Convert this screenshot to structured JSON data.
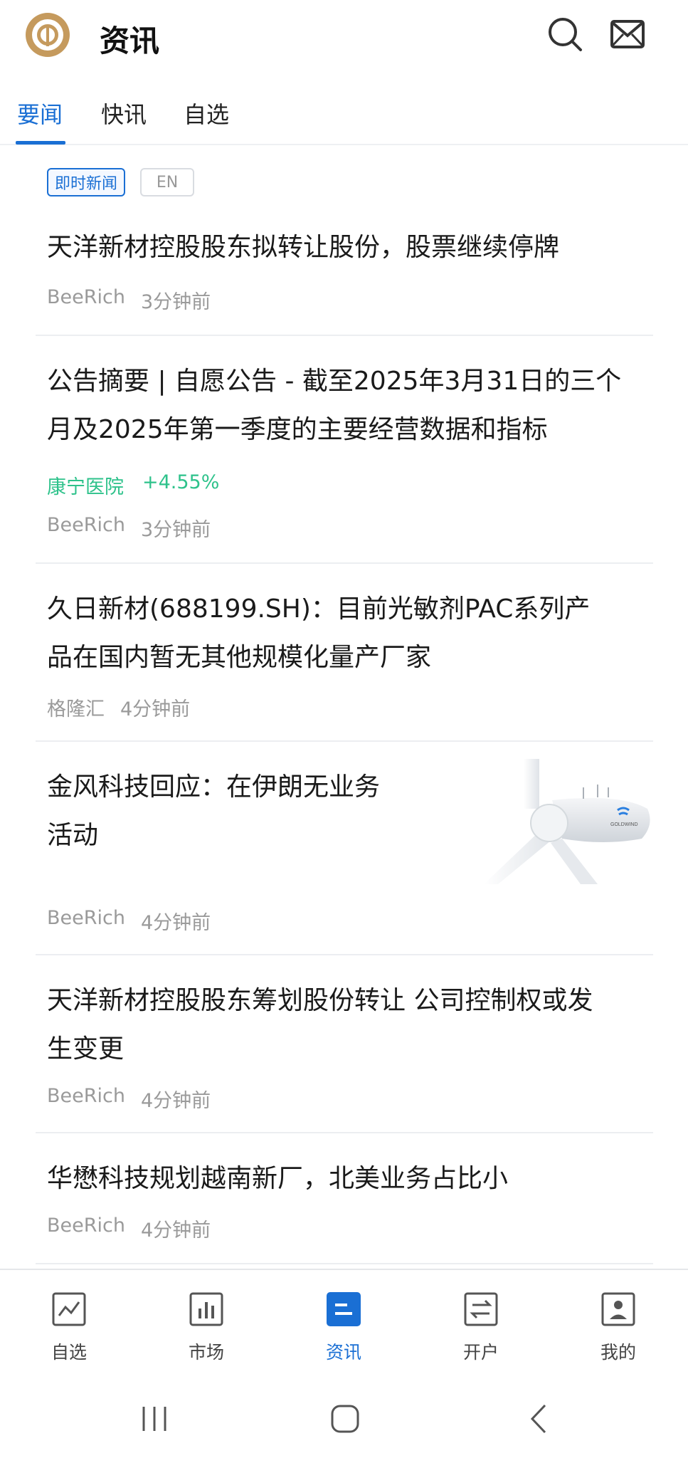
{
  "header": {
    "title": "资讯",
    "brand_color": "#c59a5d"
  },
  "tabs": [
    {
      "label": "要闻",
      "active": true
    },
    {
      "label": "快讯",
      "active": false
    },
    {
      "label": "自选",
      "active": false
    }
  ],
  "filters": {
    "news_badge": "即时新闻",
    "en_badge": "EN"
  },
  "articles": [
    {
      "title": "天洋新材控股股东拟转让股份，股票继续停牌",
      "source": "BeeRich",
      "time": "3分钟前"
    },
    {
      "title_line1": "公告摘要 | 自愿公告 - 截至2025年3月31日的三个",
      "title_line2": "月及2025年第一季度的主要经营数据和指标",
      "stock_name": "康宁医院",
      "stock_change": "+4.55%",
      "source": "BeeRich",
      "time": "3分钟前"
    },
    {
      "title_line1": "久日新材(688199.SH)：目前光敏剂PAC系列产",
      "title_line2": "品在国内暂无其他规模化量产厂家",
      "source": "格隆汇",
      "time": "4分钟前"
    },
    {
      "title_line1": "金风科技回应：在伊朗无业务",
      "title_line2": "活动",
      "source": "BeeRich",
      "time": "4分钟前",
      "image_brand": "GOLDWIND"
    },
    {
      "title_line1": "天洋新材控股股东筹划股份转让 公司控制权或发",
      "title_line2": "生变更",
      "source": "BeeRich",
      "time": "4分钟前"
    },
    {
      "title": "华懋科技规划越南新厂，北美业务占比小",
      "source": "BeeRich",
      "time": "4分钟前"
    }
  ],
  "bottom_nav": [
    {
      "label": "自选",
      "icon": "chart-line-icon",
      "active": false
    },
    {
      "label": "市场",
      "icon": "bar-chart-icon",
      "active": false
    },
    {
      "label": "资讯",
      "icon": "news-icon",
      "active": true
    },
    {
      "label": "开户",
      "icon": "transfer-icon",
      "active": false
    },
    {
      "label": "我的",
      "icon": "profile-icon",
      "active": false
    }
  ],
  "colors": {
    "accent": "#1a6fd4",
    "stock_up": "#2ec28b",
    "meta_gray": "#9a9a9a"
  }
}
